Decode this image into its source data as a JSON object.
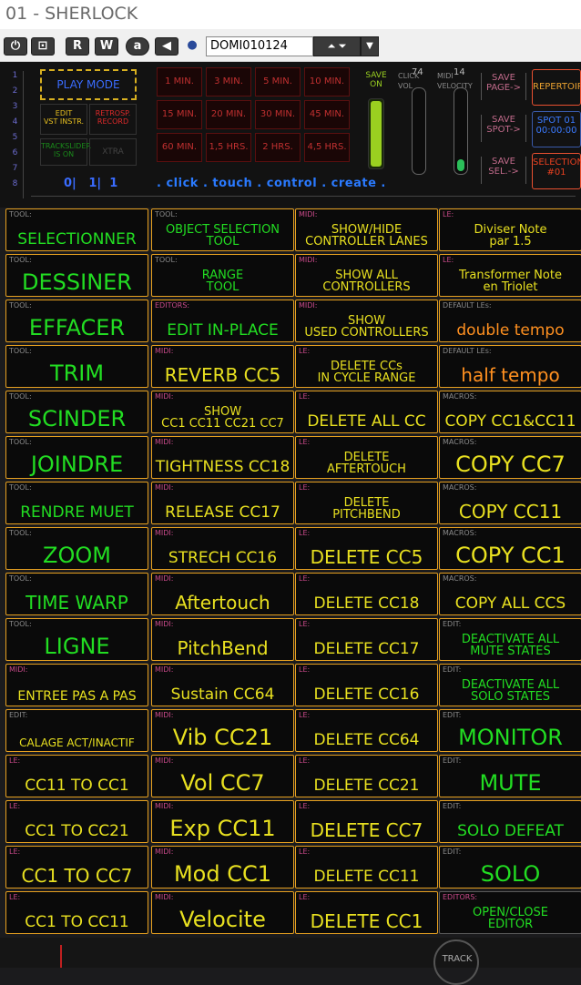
{
  "window": {
    "title": "01 - SHERLOCK"
  },
  "toolbar": {
    "buttons": [
      {
        "label": "⏻",
        "icon": "power-icon"
      },
      {
        "label": "⊡",
        "icon": "window-icon"
      },
      {
        "label": "R"
      },
      {
        "label": "W"
      },
      {
        "label": "a",
        "icon": "a-circle-icon"
      },
      {
        "label": "◀",
        "icon": "back-arrow-icon"
      },
      {
        "label": "●",
        "icon": "sphere-icon"
      }
    ],
    "session": "DOMI010124",
    "arrows": "⏶ ⏷",
    "dropdown": "▼"
  },
  "panel": {
    "track_numbers": [
      "1",
      "2",
      "3",
      "4",
      "5",
      "6",
      "7",
      "8"
    ],
    "play_mode": "PLAY MODE",
    "edit_vst": "EDIT\nVST INSTR.",
    "retrosp": "RETROSP.\nRECORD",
    "trackslider": "TRACKSLIDER\nIS ON",
    "xtra": "XTRA",
    "counter": [
      "0|",
      "1|",
      "1"
    ],
    "tagline": ". click . touch . control . create .",
    "durations": [
      "1 MIN.",
      "3 MIN.",
      "5 MIN.",
      "10 MIN.",
      "15 MIN.",
      "20 MIN.",
      "30 MIN.",
      "45 MIN.",
      "60 MIN.",
      "1,5 HRS.",
      "2 HRS.",
      "4,5 HRS."
    ],
    "save_on": "SAVE\nON",
    "click_vol_label": "CLICK VOL",
    "click_vol_value": "74",
    "midi_velocity_label": "MIDI VELOCITY",
    "midi_velocity_value": "14",
    "save_page": "SAVE\nPAGE->",
    "save_spot": "SAVE\nSPOT->",
    "save_sel": "SAVE\nSEL.->",
    "repertoire": "REPERTOIRE",
    "spot": "SPOT 01\n00:00:00",
    "selection": "SELECTION\n#01",
    "colors": {
      "accent": "#e6a020",
      "green": "#22dd22",
      "orange": "#ff9020",
      "blue": "#2a6cff"
    },
    "levels": {
      "save_on": 1.0,
      "click_vol": 0.0,
      "midi_velocity": 0.15
    }
  },
  "grid": [
    [
      {
        "cat": "TOOL:",
        "label": "SELECTIONNER"
      },
      {
        "cat": "TOOL:",
        "label": "OBJECT SELECTION\nTOOL"
      },
      {
        "cat": "MIDI:",
        "label": "SHOW/HIDE\nCONTROLLER LANES"
      },
      {
        "cat": "LE:",
        "label": "Diviser Note\npar 1.5"
      }
    ],
    [
      {
        "cat": "TOOL:",
        "label": "DESSINER"
      },
      {
        "cat": "TOOL:",
        "label": "RANGE\nTOOL"
      },
      {
        "cat": "MIDI:",
        "label": "SHOW ALL\nCONTROLLERS"
      },
      {
        "cat": "LE:",
        "label": "Transformer Note\nen Triolet"
      }
    ],
    [
      {
        "cat": "TOOL:",
        "label": "EFFACER"
      },
      {
        "cat": "EDITORS:",
        "label": "EDIT IN-PLACE"
      },
      {
        "cat": "MIDI:",
        "label": "SHOW\nUSED CONTROLLERS"
      },
      {
        "cat": "DEFAULT LEs:",
        "label": "double tempo"
      }
    ],
    [
      {
        "cat": "TOOL:",
        "label": "TRIM"
      },
      {
        "cat": "MIDI:",
        "label": "REVERB CC5"
      },
      {
        "cat": "LE:",
        "label": "DELETE CCs\nIN CYCLE RANGE"
      },
      {
        "cat": "DEFAULT LEs:",
        "label": "half tempo"
      }
    ],
    [
      {
        "cat": "TOOL:",
        "label": "SCINDER"
      },
      {
        "cat": "MIDI:",
        "label": "SHOW\nCC1 CC11 CC21 CC7"
      },
      {
        "cat": "LE:",
        "label": "DELETE ALL CC"
      },
      {
        "cat": "MACROS:",
        "label": "COPY CC1&CC11"
      }
    ],
    [
      {
        "cat": "TOOL:",
        "label": "JOINDRE"
      },
      {
        "cat": "MIDI:",
        "label": "TIGHTNESS CC18"
      },
      {
        "cat": "LE:",
        "label": "DELETE\nAFTERTOUCH"
      },
      {
        "cat": "MACROS:",
        "label": "COPY CC7"
      }
    ],
    [
      {
        "cat": "TOOL:",
        "label": "RENDRE MUET"
      },
      {
        "cat": "MIDI:",
        "label": "RELEASE CC17"
      },
      {
        "cat": "LE:",
        "label": "DELETE\nPITCHBEND"
      },
      {
        "cat": "MACROS:",
        "label": "COPY CC11"
      }
    ],
    [
      {
        "cat": "TOOL:",
        "label": "ZOOM"
      },
      {
        "cat": "MIDI:",
        "label": "STRECH CC16"
      },
      {
        "cat": "LE:",
        "label": "DELETE CC5"
      },
      {
        "cat": "MACROS:",
        "label": "COPY CC1"
      }
    ],
    [
      {
        "cat": "TOOL:",
        "label": "TIME WARP"
      },
      {
        "cat": "MIDI:",
        "label": "Aftertouch"
      },
      {
        "cat": "LE:",
        "label": "DELETE CC18"
      },
      {
        "cat": "MACROS:",
        "label": "COPY ALL CCS"
      }
    ],
    [
      {
        "cat": "TOOL:",
        "label": "LIGNE"
      },
      {
        "cat": "MIDI:",
        "label": "PitchBend"
      },
      {
        "cat": "LE:",
        "label": "DELETE CC17"
      },
      {
        "cat": "EDIT:",
        "label": "DEACTIVATE ALL\nMUTE STATES"
      }
    ],
    [
      {
        "cat": "MIDI:",
        "label": "ENTREE PAS A PAS"
      },
      {
        "cat": "MIDI:",
        "label": "Sustain CC64"
      },
      {
        "cat": "LE:",
        "label": "DELETE CC16"
      },
      {
        "cat": "EDIT:",
        "label": "DEACTIVATE ALL\nSOLO STATES"
      }
    ],
    [
      {
        "cat": "EDIT:",
        "label": "CALAGE ACT/INACTIF"
      },
      {
        "cat": "MIDI:",
        "label": "Vib CC21"
      },
      {
        "cat": "LE:",
        "label": "DELETE CC64"
      },
      {
        "cat": "EDIT:",
        "label": "MONITOR"
      }
    ],
    [
      {
        "cat": "LE:",
        "label": "CC11 TO CC1"
      },
      {
        "cat": "MIDI:",
        "label": "Vol CC7"
      },
      {
        "cat": "LE:",
        "label": "DELETE CC21"
      },
      {
        "cat": "EDIT:",
        "label": "MUTE"
      }
    ],
    [
      {
        "cat": "LE:",
        "label": "CC1 TO CC21"
      },
      {
        "cat": "MIDI:",
        "label": "Exp CC11"
      },
      {
        "cat": "LE:",
        "label": "DELETE CC7"
      },
      {
        "cat": "EDIT:",
        "label": "SOLO DEFEAT"
      }
    ],
    [
      {
        "cat": "LE:",
        "label": "CC1 TO CC7"
      },
      {
        "cat": "MIDI:",
        "label": "Mod CC1"
      },
      {
        "cat": "LE:",
        "label": "DELETE CC11"
      },
      {
        "cat": "EDIT:",
        "label": "SOLO"
      }
    ],
    [
      {
        "cat": "LE:",
        "label": "CC1 TO CC11"
      },
      {
        "cat": "MIDI:",
        "label": "Velocite"
      },
      {
        "cat": "LE:",
        "label": "DELETE CC1"
      },
      {
        "cat": "EDITORS:",
        "label": "OPEN/CLOSE\nEDITOR"
      }
    ]
  ],
  "footer": {
    "track_label": "TRACK"
  }
}
